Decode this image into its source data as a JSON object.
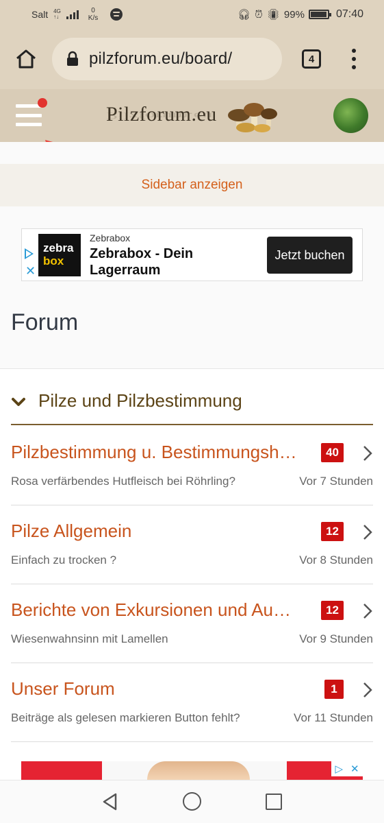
{
  "status_bar": {
    "carrier": "Salt",
    "network_type": "4G",
    "network_sub": "↑↓",
    "speed_value": "0",
    "speed_unit": "K/s",
    "battery": "99%",
    "time": "07:40"
  },
  "browser": {
    "url": "pilzforum.eu/board/",
    "tab_count": "4"
  },
  "site": {
    "logo_text": "Pilzforum.eu",
    "sidebar_toggle": "Sidebar anzeigen"
  },
  "ad": {
    "logo_line1": "zebra",
    "logo_line2": "box",
    "brand": "Zebrabox",
    "title": "Zebrabox - Dein Lagerraum",
    "cta": "Jetzt buchen",
    "close_glyph": "✕"
  },
  "page": {
    "title": "Forum"
  },
  "category": {
    "title": "Pilze und Pilzbestimmung"
  },
  "boards": [
    {
      "title": "Pilzbestimmung u. Bestimmungshilfe",
      "badge": "40",
      "last_post": "Rosa verfärbendes Hutfleisch bei Röhrling?",
      "time": "Vor 7 Stunden"
    },
    {
      "title": "Pilze Allgemein",
      "badge": "12",
      "last_post": "Einfach zu trocken ?",
      "time": "Vor 8 Stunden"
    },
    {
      "title": "Berichte von Exkursionen und Ausflügen",
      "badge": "12",
      "last_post": "Wiesenwahnsinn mit Lamellen",
      "time": "Vor 9 Stunden"
    },
    {
      "title": "Unser Forum",
      "badge": "1",
      "last_post": "Beiträge als gelesen markieren Button fehlt?",
      "time": "Vor 11 Stunden"
    }
  ],
  "colors": {
    "header_bg": "#d9ccb7",
    "accent_orange": "#c8541d",
    "badge_red": "#cc1111",
    "arrow_red": "#e8453c"
  }
}
